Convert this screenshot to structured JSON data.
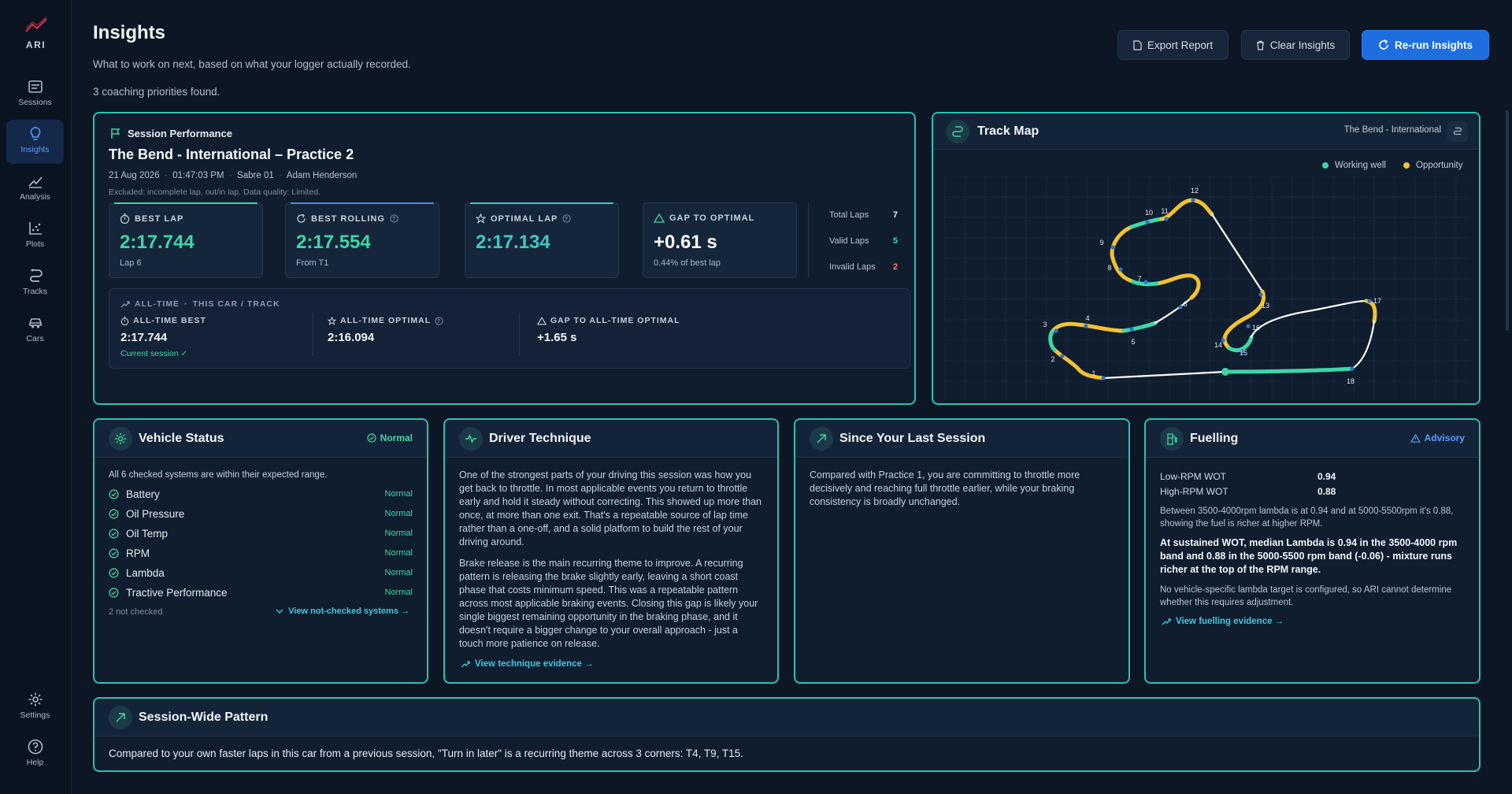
{
  "app": {
    "logo_text": "ARI"
  },
  "sidebar": {
    "items": [
      {
        "label": "Sessions",
        "icon": "sessions-icon"
      },
      {
        "label": "Insights",
        "icon": "lightbulb-icon",
        "active": true
      },
      {
        "label": "Analysis",
        "icon": "trend-icon"
      },
      {
        "label": "Plots",
        "icon": "scatter-icon"
      },
      {
        "label": "Tracks",
        "icon": "track-icon"
      },
      {
        "label": "Cars",
        "icon": "car-icon"
      }
    ],
    "bottom": [
      {
        "label": "Settings",
        "icon": "gear-icon"
      },
      {
        "label": "Help",
        "icon": "help-icon"
      }
    ]
  },
  "header": {
    "title": "Insights",
    "subtitle": "What to work on next, based on what your logger actually recorded.",
    "count": "3 coaching priorities found.",
    "export_label": "Export Report",
    "clear_label": "Clear Insights",
    "rerun_label": "Re-run Insights"
  },
  "session": {
    "tag": "Session Performance",
    "title": "The Bend - International  –  Practice 2",
    "date": "21 Aug 2026",
    "time": "01:47:03 PM",
    "car": "Sabre 01",
    "driver": "Adam Henderson",
    "note": "Excluded: incomplete lap, out/in lap.   Data quality: Limited.",
    "stats": [
      {
        "label": "BEST LAP",
        "value": "2:17.744",
        "sub": "Lap 6",
        "color": "#3fd6a6"
      },
      {
        "label": "BEST ROLLING",
        "value": "2:17.554",
        "sub": "From T1",
        "color": "#3fd6a6"
      },
      {
        "label": "OPTIMAL LAP",
        "value": "2:17.134",
        "sub": "",
        "color": "#3fc9c5"
      },
      {
        "label": "GAP TO OPTIMAL",
        "value": "+0.61 s",
        "sub": "0.44% of best lap",
        "color": "#ffffff"
      }
    ],
    "laps": [
      {
        "label": "Total Laps",
        "value": "7"
      },
      {
        "label": "Valid Laps",
        "value": "5"
      },
      {
        "label": "Invalid Laps",
        "value": "2"
      }
    ],
    "alltime": {
      "heading": "ALL-TIME",
      "context": "THIS CAR / TRACK",
      "best_label": "ALL-TIME BEST",
      "best_value": "2:17.744",
      "best_note": "Current session ✓",
      "optimal_label": "ALL-TIME OPTIMAL",
      "optimal_value": "2:16.094",
      "gap_label": "GAP TO ALL-TIME OPTIMAL",
      "gap_value": "+1.65 s"
    }
  },
  "trackmap": {
    "title": "Track Map",
    "track_name": "The Bend - International",
    "legend_good": "Working well",
    "legend_opp": "Opportunity",
    "corners": [
      "1",
      "2",
      "3",
      "4",
      "5",
      "6",
      "7",
      "8",
      "9",
      "10",
      "11",
      "12",
      "13",
      "14",
      "15",
      "16",
      "17",
      "18"
    ],
    "colors": {
      "good": "#3fd6a6",
      "opportunity": "#f2c232"
    }
  },
  "vehicle": {
    "title": "Vehicle Status",
    "badge": "Normal",
    "summary": "All 6 checked systems are within their expected range.",
    "systems": [
      {
        "name": "Battery",
        "status": "Normal"
      },
      {
        "name": "Oil Pressure",
        "status": "Normal"
      },
      {
        "name": "Oil Temp",
        "status": "Normal"
      },
      {
        "name": "RPM",
        "status": "Normal"
      },
      {
        "name": "Lambda",
        "status": "Normal"
      },
      {
        "name": "Tractive Performance",
        "status": "Normal"
      }
    ],
    "not_checked": "2 not checked",
    "link": "View not-checked systems →"
  },
  "technique": {
    "title": "Driver Technique",
    "p1": "One of the strongest parts of your driving this session was how you get back to throttle. In most applicable events you return to throttle early and hold it steady without correcting. This showed up more than once, at more than one exit. That's a repeatable source of lap time rather than a one-off, and a solid platform to build the rest of your driving around.",
    "p2": "Brake release is the main recurring theme to improve. A recurring pattern is releasing the brake slightly early, leaving a short coast phase that costs minimum speed. This was a repeatable pattern across most applicable braking events. Closing this gap is likely your single biggest remaining opportunity in the braking phase, and it doesn't require a bigger change to your overall approach - just a touch more patience on release.",
    "link": "View technique evidence →"
  },
  "since": {
    "title": "Since Your Last Session",
    "body": "Compared with Practice 1, you are committing to throttle more decisively and reaching full throttle earlier, while your braking consistency is broadly unchanged."
  },
  "fuelling": {
    "title": "Fuelling",
    "badge": "Advisory",
    "rows": [
      {
        "label": "Low-RPM WOT",
        "value": "0.94"
      },
      {
        "label": "High-RPM WOT",
        "value": "0.88"
      }
    ],
    "p1": "Between 3500-4000rpm lambda is at 0.94 and at 5000-5500rpm it's 0.88, showing the fuel is richer at higher RPM.",
    "p2": "At sustained WOT, median Lambda is 0.94 in the 3500-4000 rpm band and 0.88 in the 5000-5500 rpm band (-0.06) - mixture runs richer at the top of the RPM range.",
    "p3": "No vehicle-specific lambda target is configured, so ARI cannot determine whether this requires adjustment.",
    "link": "View fuelling evidence →"
  },
  "pattern": {
    "title": "Session-Wide Pattern",
    "body": "Compared to your own faster laps in this car from a previous session, \"Turn in later\" is a recurring theme across 3 corners: T4, T9, T15."
  }
}
